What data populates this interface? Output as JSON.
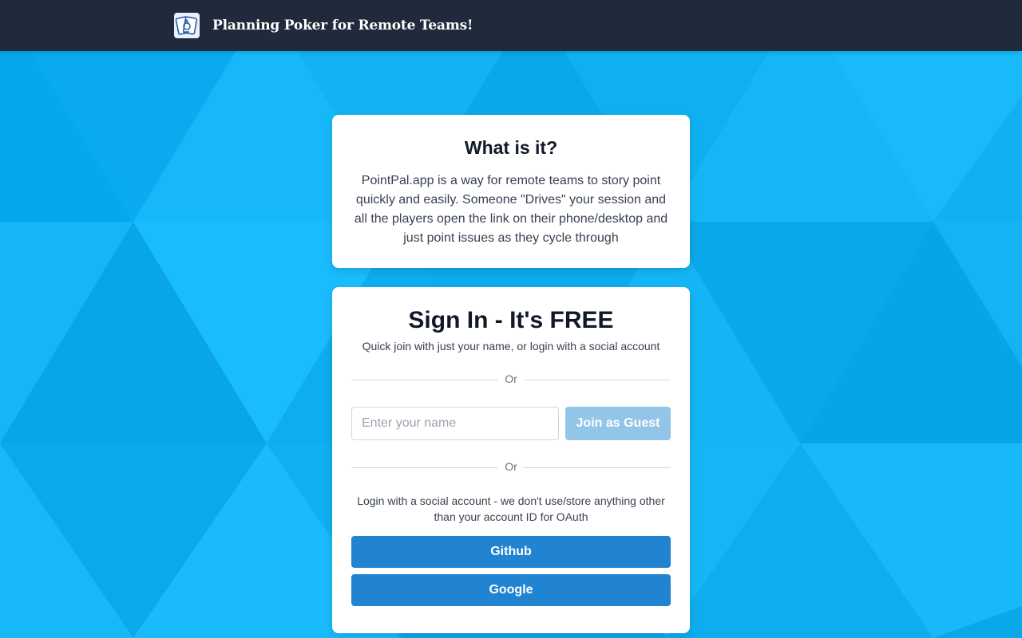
{
  "header": {
    "title": "Planning Poker for Remote Teams!",
    "logo_icon": "playing-cards-icon"
  },
  "about": {
    "heading": "What is it?",
    "body": "PointPal.app is a way for remote teams to story point quickly and easily. Someone \"Drives\" your session and all the players open the link on their phone/desktop and just point issues as they cycle through"
  },
  "signin": {
    "heading": "Sign In - It's FREE",
    "subtitle": "Quick join with just your name, or login with a social account",
    "divider_text": "Or",
    "name_placeholder": "Enter your name",
    "name_value": "",
    "guest_button": "Join as Guest",
    "social_note": "Login with a social account - we don't use/store anything other than your account ID for OAuth",
    "github_button": "Github",
    "google_button": "Google"
  },
  "colors": {
    "navbar": "#202a3b",
    "background": "#12b4f5",
    "guest_button": "#93c5e8",
    "social_button": "#2184d0"
  }
}
